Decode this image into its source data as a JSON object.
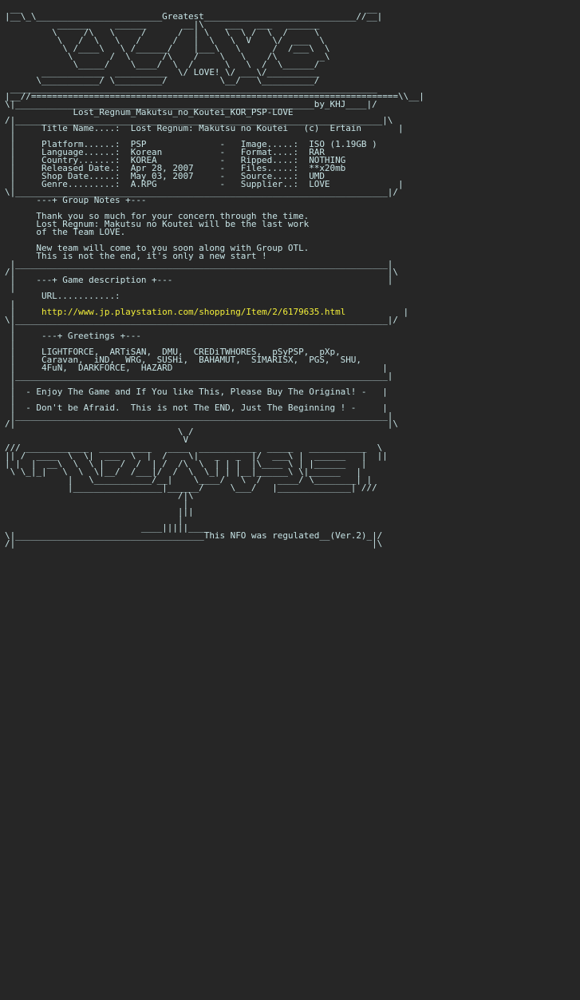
{
  "colors": {
    "background": "#262626",
    "text": "#c7e4e6",
    "link": "#f2ee3a"
  },
  "nfo": {
    "logo_top": [
      " __                                                                  __",
      "|__\\_\\________________________Greatest_____________________________//__|",
      "          ______     ______       __|\\    ___   ___   ______",
      "         \\     /\\   \\     /      /  | \\   \\  \\ /  \\  /     \\",
      "          \\   /  \\   \\   /      /   |  \\   \\  V    \\/  ___  \\",
      "           \\ /____\\   \\ /______/    |___\\   \\      /  /___\\  \\",
      "            \\       /  \\      /\\    /    \\   \\    /\\        _\\",
      "             \\_____/    \\____/  \\  /      \\   \\  /  \\______/",
      "       ____________  __________  \\/ LOVE! \\/ ___\\/__________",
      "      \\___________/ \\_________/          \\__/   \\__________/"
    ],
    "divider_top": [
      " ______________________________________________________________________",
      "|__//======================================================================\\\\__|"
    ],
    "header": {
      "border_top": "\\|_________________________________________________________by_KHJ____|/",
      "release_name": "Lost_Regnum_Makutsu_no_Koutei_KOR_PSP-LOVE",
      "border_bottom": "/|______________________________________________________________________|\\"
    },
    "info": [
      " |     Title Name....:  Lost Regnum: Makutsu no Koutei   (c)  Ertain       |",
      " |",
      " |     Platform......:  PSP              -   Image.....:  ISO (1.19GB )",
      " |     Language......:  Korean           -   Format....:  RAR",
      " |     Country.......:  KOREA            -   Ripped....:  NOTHING",
      " |     Released Date.:  Apr 28, 2007     -   Files.....:  **x20mb",
      " |     Shop Date.....:  May 03, 2007     -   Source....:  UMD",
      " |     Genre.........:  A.RPG            -   Supplier..:  LOVE             |",
      "\\|_______________________________________________________________________|/"
    ],
    "notes": [
      "      ---+ Group Notes +---",
      "",
      "      Thank you so much for your concern through the time.",
      "      Lost Regnum: Makutsu no Koutei will be the last work",
      "      of the Team LOVE.",
      "",
      "      New team will come to you soon along with Group OTL.",
      "      This is not the end, it's only a new start !",
      " |_______________________________________________________________________|",
      "/|                                                                       |\\"
    ],
    "description": [
      " |    ---+ Game description +---                                         |",
      " |",
      "       URL...........:",
      " |"
    ],
    "url_indent": " |     ",
    "url_line_end": "           |",
    "url": "http://www.jp.playstation.com/shopping/Item/2/6179635.html",
    "greetings": [
      "\\|_______________________________________________________________________|/",
      " |",
      " |     ---+ Greetings +---",
      " |",
      " |     LIGHTFORCE,  ARTiSAN,  DMU,  CREDiTWHORES,  pSyPSP,  pXp,",
      " |     Caravan,  iND,  WRG,  SUSHi,  BAHAMUT,  SIMARISX,  PGS,  SHU,",
      " |     4FuN,  DARKFORCE,  HAZARD                                        |",
      " |_______________________________________________________________________|",
      " |",
      " |  - Enjoy The Game and If You like This, Please Buy The Original! -   |",
      " |",
      " |  - Don't be Afraid.  This is not The END, Just The Beginning ! -     |",
      " |_______________________________________________________________________|",
      "/|                                                                       |\\"
    ],
    "logo_bottom": [
      "                                 \\ /",
      "                                  V",
      "/// ____________  __________   ____  ___________  _____   ___________  \\",
      "|| /  ____  \\  \\|  ___  \\  |  /    \\|   _   _  |/  ___\\ |  ______   |  ||",
      "| |  |  __\\  \\  \\ |   /  /  | /  /\\  \\  | | |  |\\____ \\ | |______   |",
      " \\ \\_|_|   \\  \\  \\|__/  /___|/  /  \\  \\_| | |__|______\\ \\|______   |",
      "            |   \\___________/__|    \\____/   \\  /   ____/ \\________| |",
      "            |_________________|______/     \\___/   |______________| ///",
      "                                 /|\\",
      "                                  |",
      "                                 |||",
      "                                 |",
      "                          ____|||||____"
    ],
    "footer": [
      "\\|____________________________________This NFO was regulated__(Ver.2)_|/",
      "/|                                                                    |\\"
    ]
  }
}
